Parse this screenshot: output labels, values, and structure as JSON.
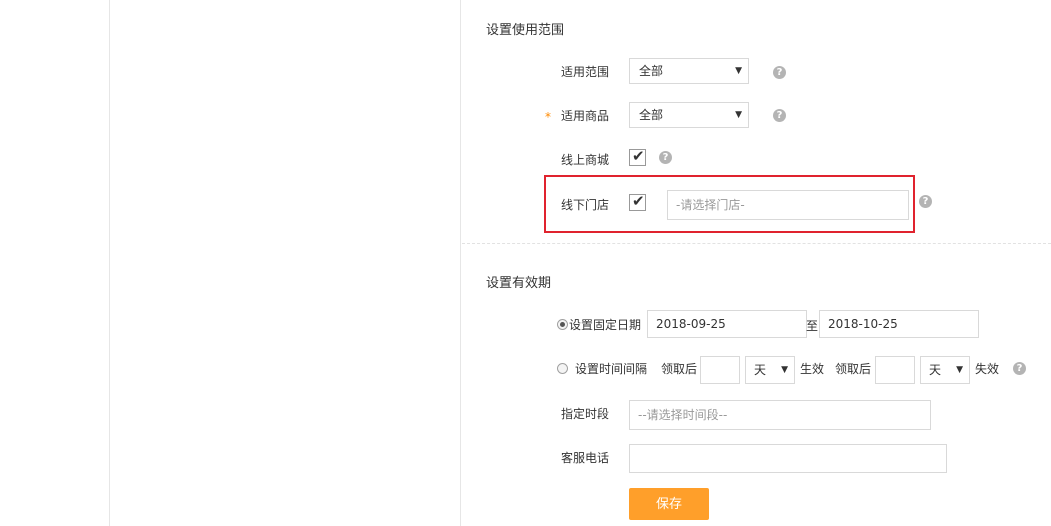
{
  "scope_section": {
    "title": "设置使用范围",
    "scope_label": "适用范围",
    "scope_value": "全部",
    "goods_required_mark": "*",
    "goods_label": "适用商品",
    "goods_value": "全部",
    "online_label": "线上商城",
    "offline_label": "线下门店",
    "store_placeholder": "-请选择门店-",
    "help_glyph": "?"
  },
  "validity_section": {
    "title": "设置有效期",
    "fixed_date_label": "设置固定日期",
    "start_date": "2018-09-25",
    "to_label": "至",
    "end_date": "2018-10-25",
    "interval_label": "设置时间间隔",
    "receive_after_label": "领取后",
    "unit_day": "天",
    "effective_label": "生效",
    "receive_after_label_2": "领取后",
    "unit_day_2": "天",
    "expire_label": "失效",
    "time_slot_label": "指定时段",
    "time_slot_placeholder": "--请选择时间段--",
    "phone_label": "客服电话",
    "phone_value": "",
    "save_label": "保存"
  },
  "colors": {
    "accent": "#ff9f2a",
    "highlight": "#e0232e"
  }
}
